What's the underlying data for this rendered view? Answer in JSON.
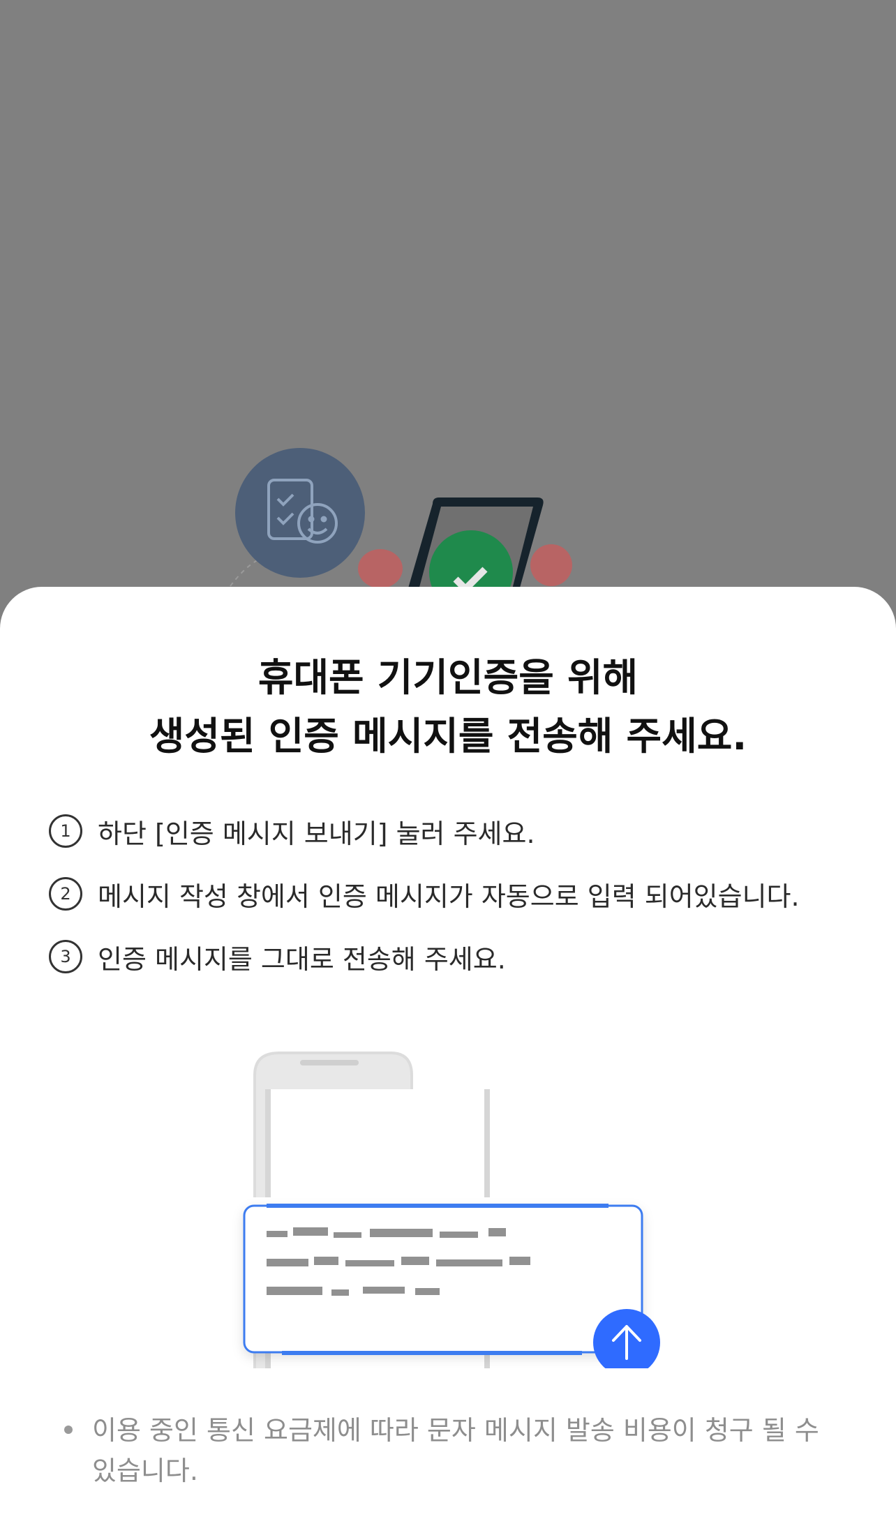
{
  "title": {
    "line1": "휴대폰 기기인증을 위해",
    "line2": "생성된 인증 메시지를 전송해 주세요."
  },
  "steps": [
    {
      "num": "1",
      "text": "하단 [인증 메시지 보내기] 눌러 주세요."
    },
    {
      "num": "2",
      "text": "메시지 작성 창에서 인증 메시지가 자동으로 입력 되어있습니다."
    },
    {
      "num": "3",
      "text": "인증 메시지를 그대로 전송해 주세요."
    }
  ],
  "note": "이용 중인 통신 요금제에 따라 문자 메시지 발송 비용이 청구 될 수 있습니다.",
  "colors": {
    "overlay": "#808080",
    "accent_blue": "#3d7cf0",
    "send_button": "#2f6bff",
    "check_green": "#1f8a4c"
  },
  "icons": [
    "checklist-smile-icon",
    "phone-check-icon",
    "send-arrow-icon"
  ]
}
